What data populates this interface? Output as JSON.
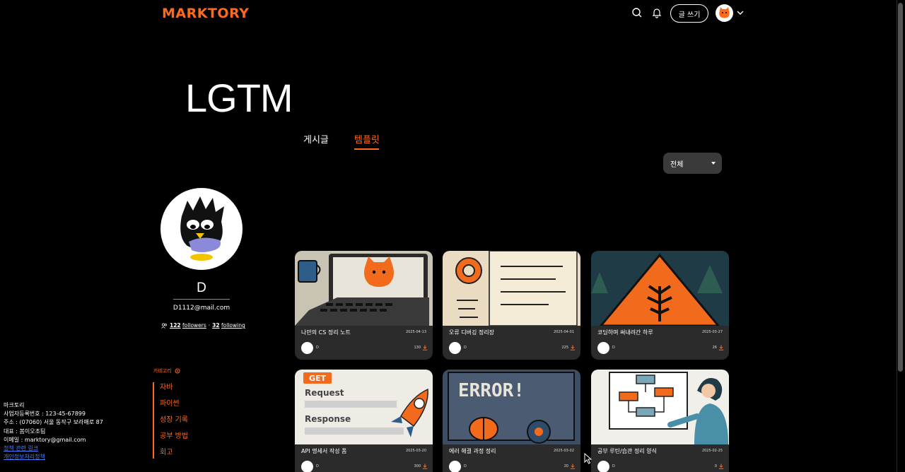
{
  "header": {
    "logo": "MARKTORY",
    "write_label": "글 쓰기"
  },
  "page": {
    "title": "LGTM",
    "tabs": [
      {
        "label": "게시글",
        "active": false
      },
      {
        "label": "템플릿",
        "active": true
      }
    ],
    "filter": {
      "selected": "전체"
    }
  },
  "profile": {
    "name": "D",
    "email": "D1112@mail.com",
    "followers_count": "122",
    "followers_label": "followers",
    "separator": "·",
    "following_count": "32",
    "following_label": "following"
  },
  "categories": {
    "title": "카테고리",
    "items": [
      "자바",
      "파이썬",
      "성장 기록",
      "공부 방법",
      "회고"
    ]
  },
  "footer": {
    "company": "마크토리",
    "biz_no": "사업자등록번호 : 123-45-67899",
    "address": "주소 : (07060) 서울 동작구 보라매로 87",
    "ceo": "대표 : 봄이오조팀",
    "email": "이메일 : marktory@gmail.com",
    "policy_link": "정책 관련 링크",
    "privacy_link": "개인정보처리정책"
  },
  "cards": [
    {
      "title": "나만의 CS 정리 노트",
      "date": "2025-04-13",
      "author": "D",
      "count": "130"
    },
    {
      "title": "오류 디버깅 정리장",
      "date": "2025-04-01",
      "author": "D",
      "count": "225"
    },
    {
      "title": "코딩하며 써내려간 하루",
      "date": "2025-03-27",
      "author": "D",
      "count": "26"
    },
    {
      "title": "API 명세서 작성 폼",
      "date": "2025-03-20",
      "author": "D",
      "count": "300"
    },
    {
      "title": "에러 해결 과정 정리",
      "date": "2025-03-02",
      "author": "D",
      "count": "20"
    },
    {
      "title": "공부 루틴/습관 정리 양식",
      "date": "2025-02-25",
      "author": "D",
      "count": "0"
    }
  ],
  "thumb_text": {
    "api_get": "GET",
    "api_request": "Request",
    "api_response": "Response",
    "error": "ERROR!"
  },
  "colors": {
    "accent": "#ff6a1a",
    "card_bg": "#2b2b2b",
    "filter_bg": "#3a3a3a"
  }
}
